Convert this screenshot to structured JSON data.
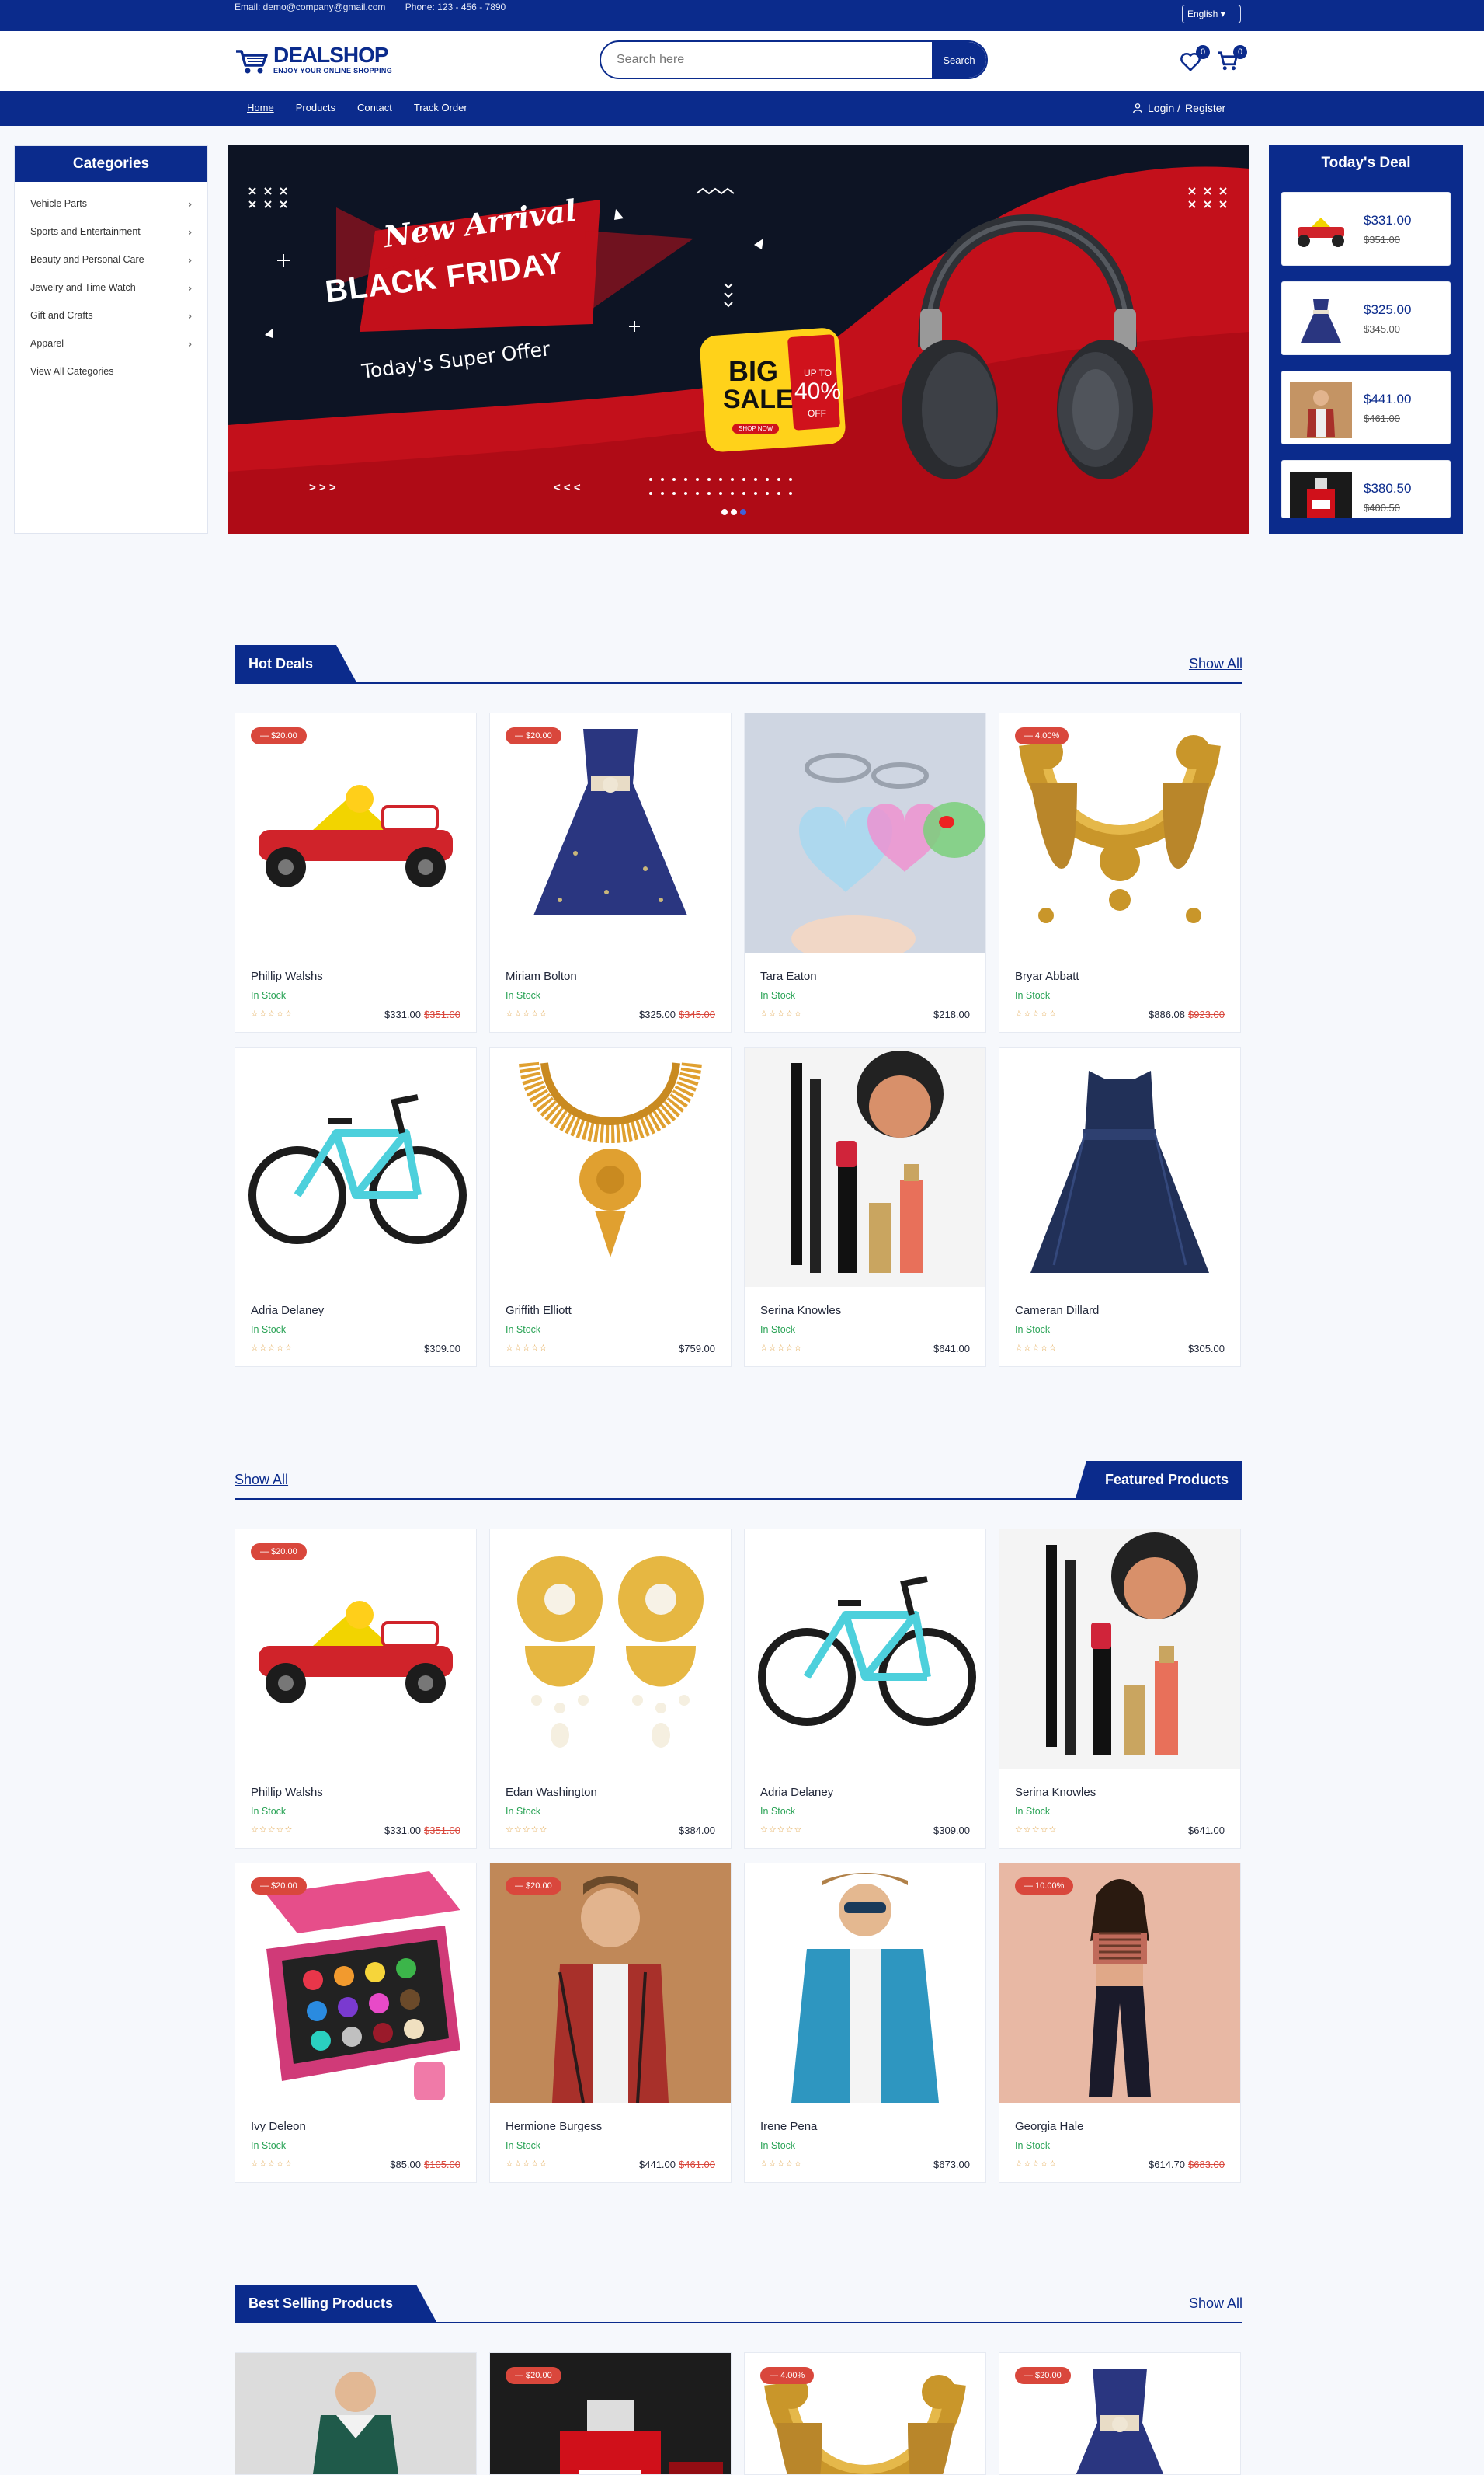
{
  "topbar": {
    "email": "Email: demo@company@gmail.com",
    "phone": "Phone: 123 - 456 - 7890",
    "language": "English"
  },
  "header": {
    "brand": "DEALSHOP",
    "tagline": "ENJOY YOUR ONLINE SHOPPING",
    "search_placeholder": "Search here",
    "search_button": "Search",
    "wishlist_count": "0",
    "cart_count": "0"
  },
  "nav": {
    "links": [
      "Home",
      "Products",
      "Contact",
      "Track Order"
    ],
    "login": "Login /",
    "register": "Register"
  },
  "categories": {
    "title": "Categories",
    "items": [
      "Vehicle Parts",
      "Sports and Entertainment",
      "Beauty and Personal Care",
      "Jewelry and Time Watch",
      "Gift and Crafts",
      "Apparel",
      "View All Categories"
    ]
  },
  "hero": {
    "line1": "New Arrival",
    "line2": "BLACK FRIDAY",
    "line3": "Today's Super Offer",
    "big": "BIG",
    "sale": "SALE",
    "upto": "UP TO",
    "percent": "40%",
    "off": "OFF",
    "shop_now": "SHOP NOW",
    "arrows_left": "> > >",
    "arrows_right": "< < <"
  },
  "todays_deal": {
    "title": "Today's Deal",
    "items": [
      {
        "price": "$331.00",
        "old": "$351.00",
        "icon": "go-kart"
      },
      {
        "price": "$325.00",
        "old": "$345.00",
        "icon": "dress"
      },
      {
        "price": "$441.00",
        "old": "$461.00",
        "icon": "man-shirt"
      },
      {
        "price": "$380.50",
        "old": "$400.50",
        "icon": "perfume"
      }
    ]
  },
  "hot_deals": {
    "title": "Hot Deals",
    "show_all": "Show All",
    "products": [
      {
        "name": "Phillip Walshs",
        "stock": "In Stock",
        "price": "$331.00",
        "old": "$351.00",
        "discount": "— $20.00",
        "icon": "go-kart"
      },
      {
        "name": "Miriam Bolton",
        "stock": "In Stock",
        "price": "$325.00",
        "old": "$345.00",
        "discount": "— $20.00",
        "icon": "dress"
      },
      {
        "name": "Tara Eaton",
        "stock": "In Stock",
        "price": "$218.00",
        "old": "",
        "discount": "",
        "icon": "keychain"
      },
      {
        "name": "Bryar Abbatt",
        "stock": "In Stock",
        "price": "$886.08",
        "old": "$923.00",
        "discount": "— 4.00%",
        "icon": "necklace"
      },
      {
        "name": "Adria Delaney",
        "stock": "In Stock",
        "price": "$309.00",
        "old": "",
        "discount": "",
        "icon": "bicycle"
      },
      {
        "name": "Griffith Elliott",
        "stock": "In Stock",
        "price": "$759.00",
        "old": "",
        "discount": "",
        "icon": "gold-chain"
      },
      {
        "name": "Serina Knowles",
        "stock": "In Stock",
        "price": "$641.00",
        "old": "",
        "discount": "",
        "icon": "makeup"
      },
      {
        "name": "Cameran Dillard",
        "stock": "In Stock",
        "price": "$305.00",
        "old": "",
        "discount": "",
        "icon": "lace-dress"
      }
    ]
  },
  "featured": {
    "title": "Featured Products",
    "show_all": "Show All",
    "products": [
      {
        "name": "Phillip Walshs",
        "stock": "In Stock",
        "price": "$331.00",
        "old": "$351.00",
        "discount": "— $20.00",
        "icon": "go-kart"
      },
      {
        "name": "Edan Washington",
        "stock": "In Stock",
        "price": "$384.00",
        "old": "",
        "discount": "",
        "icon": "earrings"
      },
      {
        "name": "Adria Delaney",
        "stock": "In Stock",
        "price": "$309.00",
        "old": "",
        "discount": "",
        "icon": "bicycle"
      },
      {
        "name": "Serina Knowles",
        "stock": "In Stock",
        "price": "$641.00",
        "old": "",
        "discount": "",
        "icon": "makeup"
      },
      {
        "name": "Ivy Deleon",
        "stock": "In Stock",
        "price": "$85.00",
        "old": "$105.00",
        "discount": "— $20.00",
        "icon": "palette"
      },
      {
        "name": "Hermione Burgess",
        "stock": "In Stock",
        "price": "$441.00",
        "old": "$461.00",
        "discount": "— $20.00",
        "icon": "man-shirt"
      },
      {
        "name": "Irene Pena",
        "stock": "In Stock",
        "price": "$673.00",
        "old": "",
        "discount": "",
        "icon": "man-denim"
      },
      {
        "name": "Georgia Hale",
        "stock": "In Stock",
        "price": "$614.70",
        "old": "$683.00",
        "discount": "— 10.00%",
        "icon": "woman"
      }
    ]
  },
  "best_selling": {
    "title": "Best Selling Products",
    "show_all": "Show All",
    "products": [
      {
        "discount": "",
        "icon": "green-dress"
      },
      {
        "discount": "— $20.00",
        "icon": "perfume"
      },
      {
        "discount": "— 4.00%",
        "icon": "necklace"
      },
      {
        "discount": "— $20.00",
        "icon": "dress"
      }
    ]
  },
  "colors": {
    "primary": "#0b2b8c",
    "sale_red": "#d9473c",
    "stock_green": "#2aa356"
  }
}
